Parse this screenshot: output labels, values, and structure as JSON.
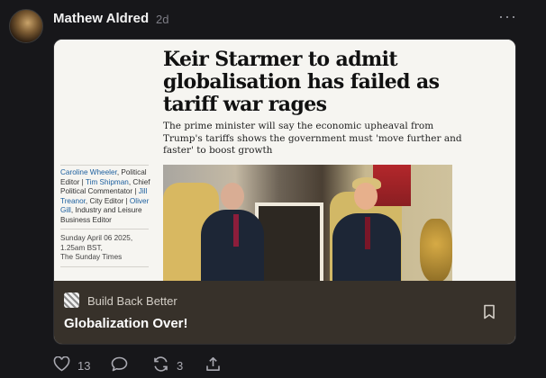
{
  "post": {
    "author": "Mathew Aldred",
    "age": "2d",
    "more_label": "···"
  },
  "article": {
    "headline": "Keir Starmer to admit globalisation has failed as tariff war rages",
    "standfirst": "The prime minister will say the economic upheaval from Trump's tariffs shows the government must 'move further and faster' to boost growth",
    "byline": {
      "part1": "Caroline Wheeler",
      "part2": ", Political Editor | ",
      "part3": "Tim Shipman",
      "part4": ", Chief Political Commentator | ",
      "part5": "Jill Treanor",
      "part6": ", City Editor | ",
      "part7": "Oliver Gill",
      "part8": ", Industry and Leisure Business Editor"
    },
    "dateline_1": "Sunday April 06 2025,",
    "dateline_2": "1.25am BST,",
    "dateline_3": "The Sunday Times"
  },
  "link_card": {
    "publication": "Build Back Better",
    "title": "Globalization Over!"
  },
  "actions": {
    "likes": "13",
    "reposts": "3"
  },
  "colors": {
    "background": "#17171a",
    "card_footer": "#37312a",
    "link_blue": "#1b5e9e"
  },
  "icons": [
    "heart-icon",
    "comment-icon",
    "repost-icon",
    "share-icon",
    "bookmark-icon",
    "more-icon"
  ]
}
